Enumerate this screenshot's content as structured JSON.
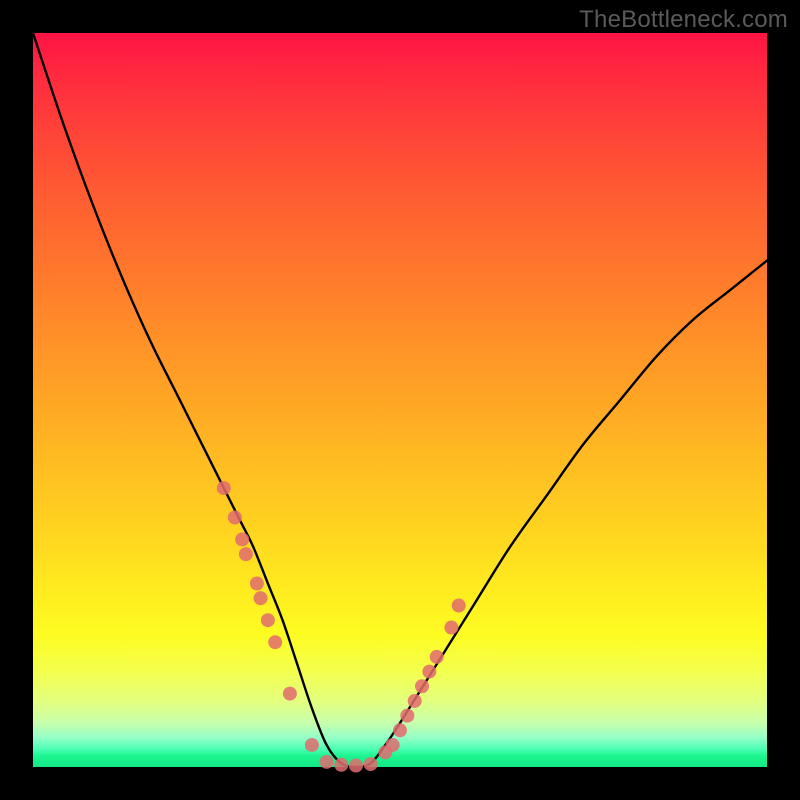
{
  "watermark": "TheBottleneck.com",
  "chart_data": {
    "type": "line",
    "title": "",
    "xlabel": "",
    "ylabel": "",
    "xlim": [
      0,
      100
    ],
    "ylim": [
      0,
      100
    ],
    "grid": false,
    "legend": false,
    "series": [
      {
        "name": "bottleneck-curve",
        "color": "#000000",
        "x": [
          0,
          4,
          8,
          12,
          16,
          20,
          24,
          28,
          30,
          32,
          34,
          36,
          38,
          40,
          42,
          44,
          46,
          48,
          50,
          55,
          60,
          65,
          70,
          75,
          80,
          85,
          90,
          95,
          100
        ],
        "y": [
          100,
          88,
          77,
          67,
          58,
          50,
          42,
          34,
          30,
          25,
          20,
          14,
          8,
          3,
          0.5,
          0,
          0.5,
          3,
          6,
          14,
          22,
          30,
          37,
          44,
          50,
          56,
          61,
          65,
          69
        ]
      }
    ],
    "markers": {
      "name": "sample-points",
      "color": "#e26b6e",
      "radius_px": 7,
      "x": [
        26,
        27.5,
        28.5,
        29,
        30.5,
        31,
        32,
        33,
        35,
        38,
        40,
        42,
        44,
        46,
        48,
        49,
        50,
        51,
        52,
        53,
        54,
        55,
        57,
        58
      ],
      "y": [
        38,
        34,
        31,
        29,
        25,
        23,
        20,
        17,
        10,
        3,
        0.7,
        0.3,
        0.2,
        0.4,
        2,
        3,
        5,
        7,
        9,
        11,
        13,
        15,
        19,
        22
      ]
    },
    "bands": [
      {
        "name": "green-band",
        "y0": 0,
        "y1": 3,
        "colors": [
          "#14e886",
          "#4fffb5"
        ]
      },
      {
        "name": "lime-band",
        "y0": 3,
        "y1": 12,
        "colors": [
          "#94ffc7",
          "#f4ff4e"
        ]
      },
      {
        "name": "yellow-band",
        "y0": 12,
        "y1": 40,
        "colors": [
          "#fdfc22",
          "#ffbb22"
        ]
      },
      {
        "name": "orange-band",
        "y0": 40,
        "y1": 70,
        "colors": [
          "#ffa325",
          "#ff5c32"
        ]
      },
      {
        "name": "red-band",
        "y0": 70,
        "y1": 100,
        "colors": [
          "#ff4438",
          "#ff1345"
        ]
      }
    ]
  }
}
